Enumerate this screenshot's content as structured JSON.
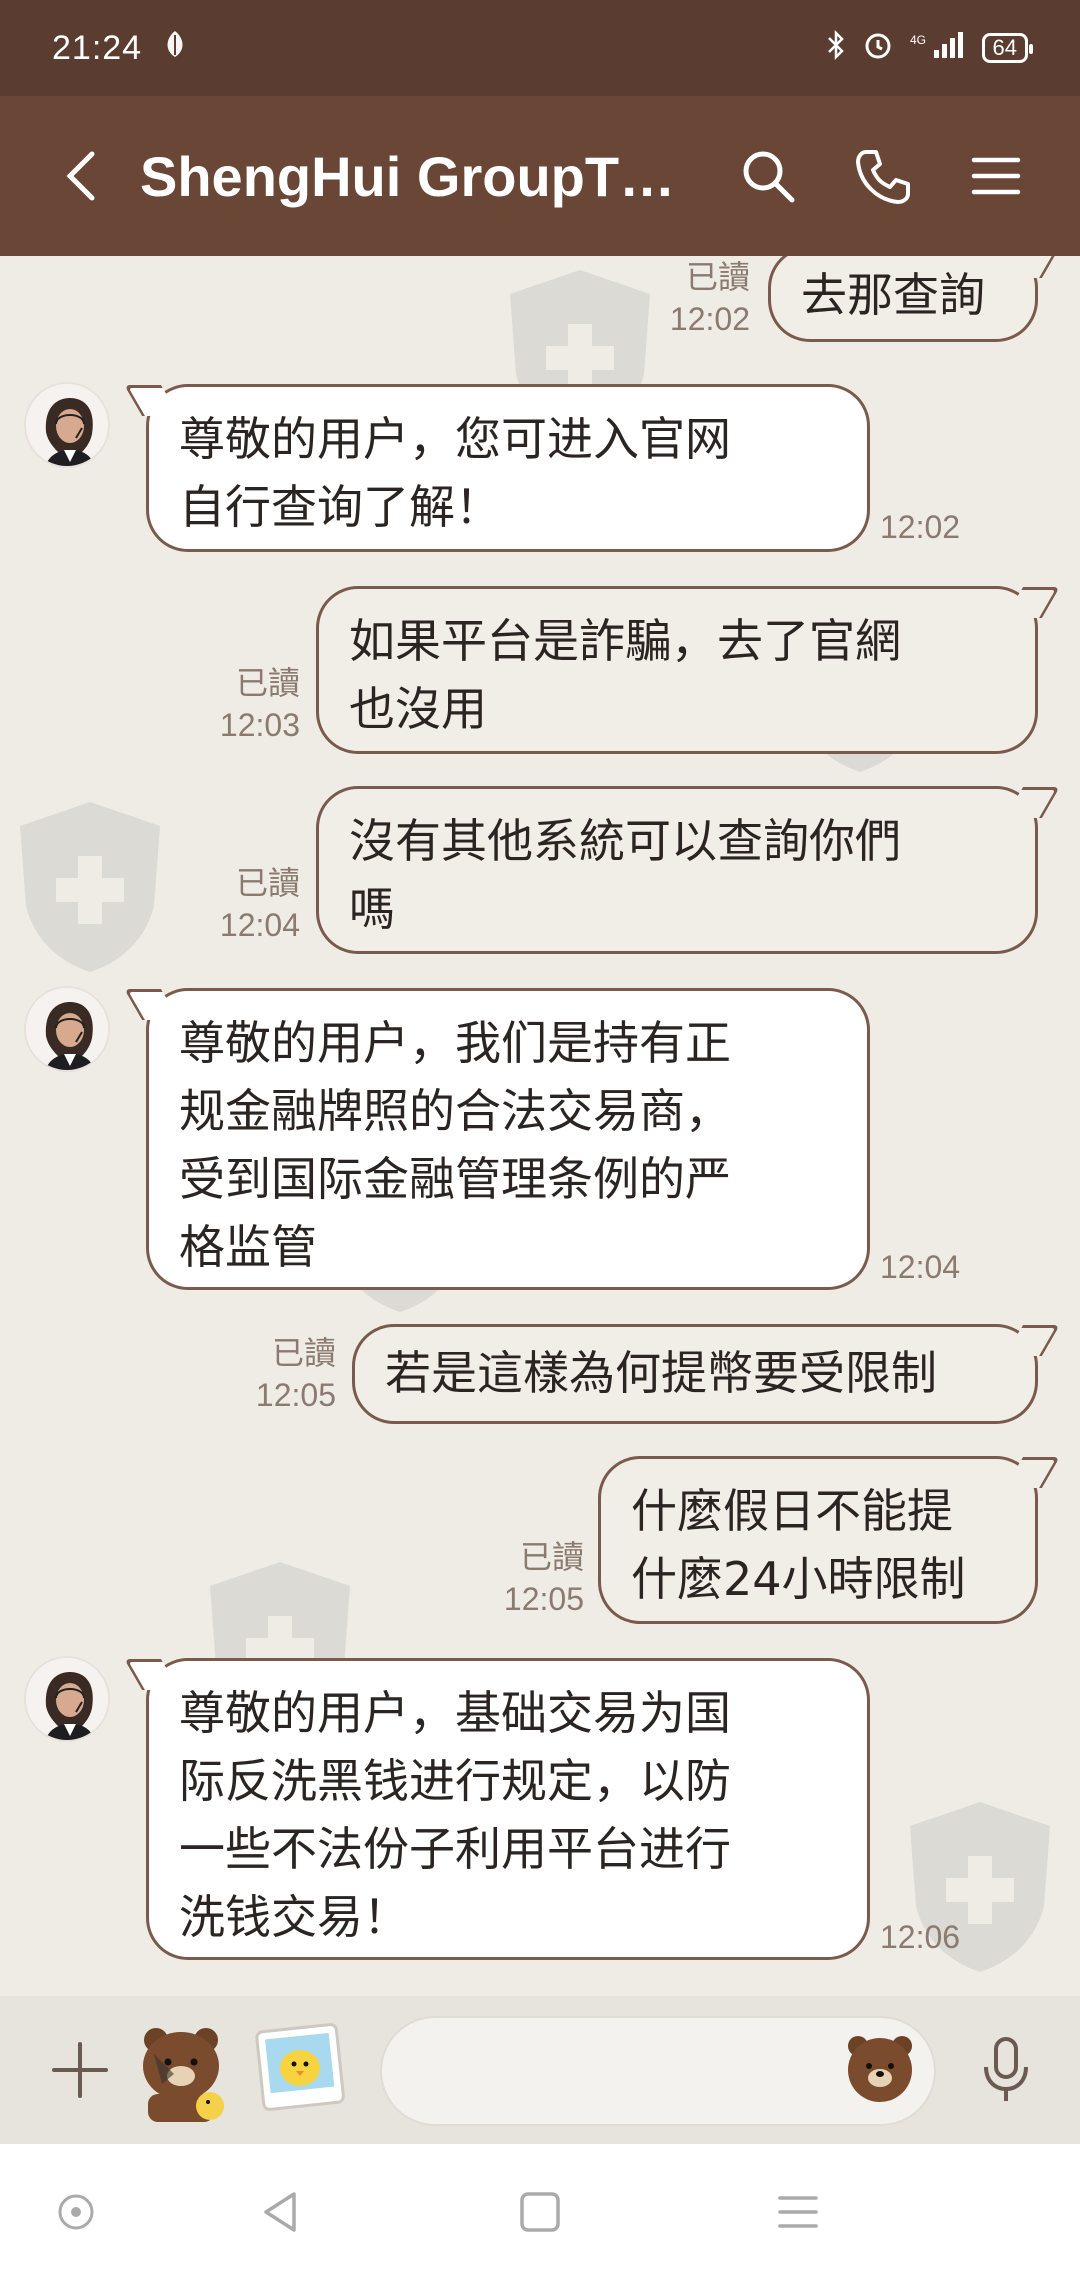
{
  "status_bar": {
    "time": "21:24",
    "battery": "64",
    "icons": [
      "leaf-icon",
      "bluetooth-icon",
      "alarm-icon",
      "signal-4g-icon",
      "battery-icon"
    ]
  },
  "header": {
    "title": "ShengHui GroupTt...",
    "icons": [
      "back-icon",
      "search-icon",
      "phone-icon",
      "menu-icon"
    ]
  },
  "messages": [
    {
      "side": "out",
      "text": "去那查詢",
      "read": "已讀",
      "time": "12:02"
    },
    {
      "side": "in",
      "lines": [
        "尊敬的用户，您可进入官网",
        "自行查询了解！"
      ],
      "time": "12:02"
    },
    {
      "side": "out",
      "lines": [
        "如果平台是詐騙，去了官網",
        "也沒用"
      ],
      "read": "已讀",
      "time": "12:03"
    },
    {
      "side": "out",
      "lines": [
        "沒有其他系統可以查詢你們",
        "嗎"
      ],
      "read": "已讀",
      "time": "12:04"
    },
    {
      "side": "in",
      "lines": [
        "尊敬的用户，我们是持有正",
        "规金融牌照的合法交易商，",
        "受到国际金融管理条例的严",
        "格监管"
      ],
      "time": "12:04"
    },
    {
      "side": "out",
      "text": "若是這樣為何提幣要受限制",
      "read": "已讀",
      "time": "12:05"
    },
    {
      "side": "out",
      "lines": [
        "什麼假日不能提",
        "什麼24小時限制"
      ],
      "read": "已讀",
      "time": "12:05"
    },
    {
      "side": "in",
      "lines": [
        "尊敬的用户，基础交易为国",
        "际反洗黑钱进行规定，以防",
        "一些不法份子利用平台进行",
        "洗钱交易！"
      ],
      "time": "12:06"
    }
  ],
  "input_bar": {
    "icons": [
      "plus-icon",
      "bear-sticker-icon",
      "chick-photo-icon",
      "bear-emoji-icon",
      "microphone-icon"
    ],
    "placeholder": ""
  },
  "nav_bar": {
    "icons": [
      "assistant-dot-icon",
      "back-triangle-icon",
      "home-square-icon",
      "menu-lines-icon"
    ]
  },
  "colors": {
    "status_bar": "#5a3d30",
    "header": "#6a4637",
    "chat_bg": "#efece6",
    "bubble_border": "#7a5a4c",
    "meta_text": "#8a7a70"
  }
}
